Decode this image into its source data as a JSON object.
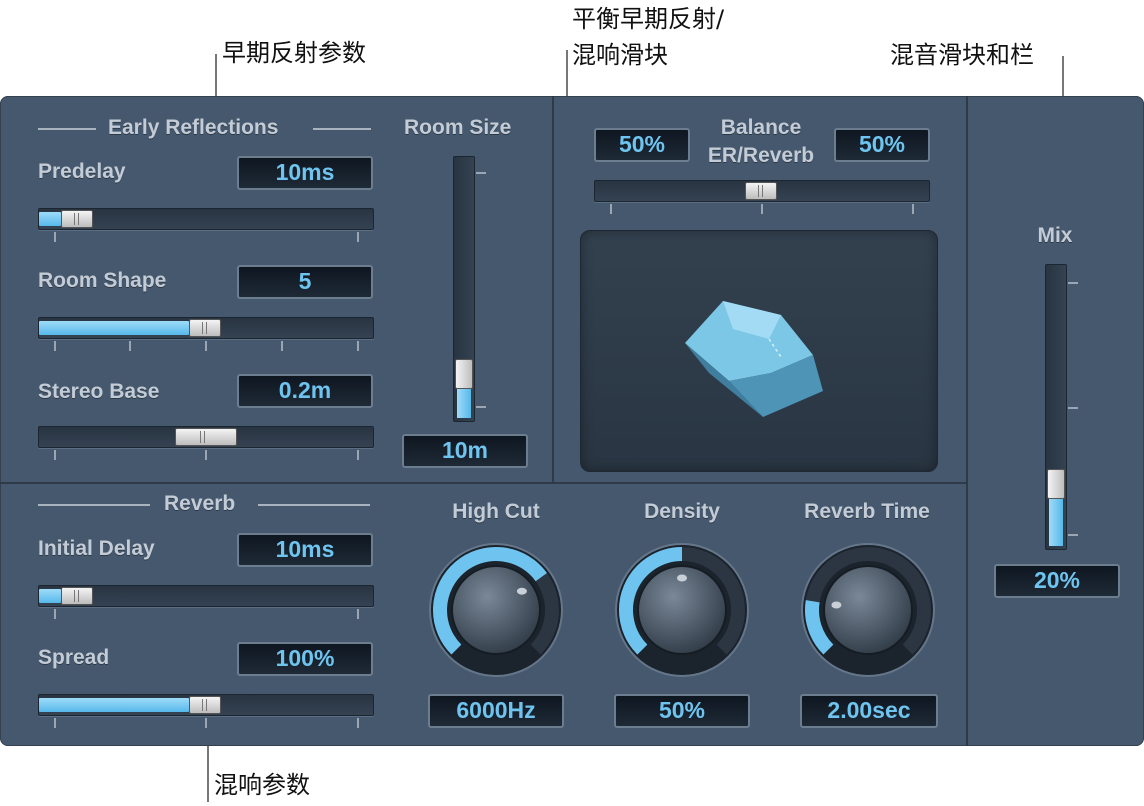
{
  "callouts": {
    "early_params": "早期反射参数",
    "balance_slider_line1": "平衡早期反射/",
    "balance_slider_line2": "混响滑块",
    "mix_slider": "混音滑块和栏",
    "reverb_params": "混响参数"
  },
  "early_reflections": {
    "title": "Early Reflections",
    "predelay": {
      "label": "Predelay",
      "value": "10ms",
      "level": 0.05
    },
    "room_shape": {
      "label": "Room Shape",
      "value": "5",
      "level": 0.5
    },
    "stereo_base": {
      "label": "Stereo Base",
      "value": "0.2m",
      "level": 0.5
    }
  },
  "room_size": {
    "label": "Room Size",
    "value": "10m",
    "level": 0.1
  },
  "balance": {
    "label_line1": "Balance",
    "label_line2": "ER/Reverb",
    "er_value": "50%",
    "reverb_value": "50%",
    "level": 0.5
  },
  "reverb": {
    "title": "Reverb",
    "initial_delay": {
      "label": "Initial Delay",
      "value": "10ms",
      "level": 0.05
    },
    "spread": {
      "label": "Spread",
      "value": "100%",
      "level": 0.5
    }
  },
  "knobs": {
    "high_cut": {
      "label": "High Cut",
      "value": "6000Hz",
      "level": 0.7
    },
    "density": {
      "label": "Density",
      "value": "50%",
      "level": 0.5
    },
    "reverb_time": {
      "label": "Reverb Time",
      "value": "2.00sec",
      "level": 0.2
    }
  },
  "mix": {
    "label": "Mix",
    "value": "20%",
    "level": 0.2
  },
  "colors": {
    "panel": "#46586d",
    "accent": "#6fc4ef",
    "fill": "#56b8ea",
    "room_shape": "#6bb6d8"
  }
}
